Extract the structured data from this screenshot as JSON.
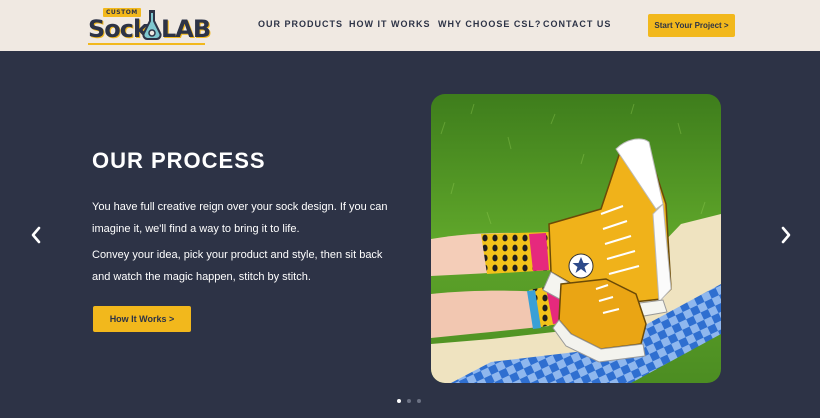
{
  "brand": {
    "badge": "CUSTOM",
    "word1": "Sock",
    "word2": "LAB"
  },
  "nav": {
    "items": [
      {
        "label": "OUR PRODUCTS"
      },
      {
        "label": "HOW IT WORKS"
      },
      {
        "label": "WHY CHOOSE CSL?"
      },
      {
        "label": "CONTACT US"
      }
    ],
    "cta_label": "Start Your Project >"
  },
  "hero": {
    "title": "OUR PROCESS",
    "paragraphs": [
      "You have full creative reign over your sock design. If you can imagine it, we'll find a way to bring it to life.",
      "Convey your idea, pick your product and style, then sit back and watch the magic happen, stitch by stitch."
    ],
    "cta_label": "How It Works >"
  },
  "carousel": {
    "slide_count": 3,
    "active_index": 0
  },
  "colors": {
    "accent": "#f2b81c",
    "navy": "#2d3346",
    "header_bg": "#f0e9e2"
  }
}
